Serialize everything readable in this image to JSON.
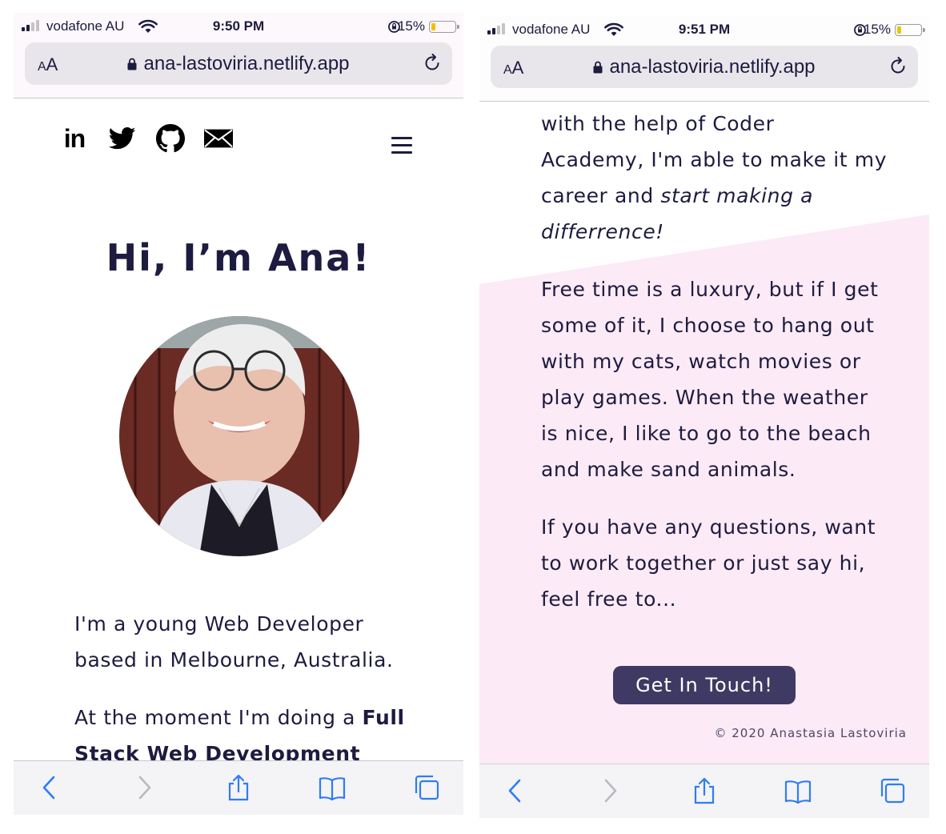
{
  "status_left": {
    "carrier": "vodafone AU",
    "time": "9:50 PM",
    "battery_percent": "15%",
    "battery_level": 0.15
  },
  "status_right": {
    "carrier": "vodafone AU",
    "time": "9:51 PM",
    "battery_percent": "15%",
    "battery_level": 0.15
  },
  "browser": {
    "text_size_label_small": "A",
    "text_size_label_large": "A",
    "url": "ana-lastoviria.netlify.app"
  },
  "nav": {
    "socials": [
      "linkedin-icon",
      "twitter-icon",
      "github-icon",
      "mail-icon"
    ],
    "linkedin_text": "in",
    "menu_icon": "hamburger-menu-icon"
  },
  "hero": {
    "title": "Hi, I’m Ana!"
  },
  "left_prose": {
    "p1_line1": "I'm a young Web Developer",
    "p1_line2": "based in Melbourne, Australia.",
    "p2_line1_a": "At the moment I'm doing a ",
    "p2_line1_b": "Full",
    "p2_line2": "Stack Web Development"
  },
  "right_prose": {
    "p1_line1": "with the help of Coder",
    "p1_line2": "Academy, I'm able to make it my",
    "p1_line3_a": "career and ",
    "p1_line3_b": "start making a",
    "p1_line4": "differrence!",
    "p2_lines": [
      "Free time is a luxury, but if I get",
      "some of it, I choose to hang out",
      "with my cats, watch movies or",
      "play games. When the weather",
      "is nice, I like to go to the beach",
      "and make sand animals."
    ],
    "p3_lines": [
      "If you have any questions, want",
      "to work together or just say hi,",
      "feel free to..."
    ]
  },
  "cta": {
    "label": "Get In Touch!"
  },
  "footer": {
    "copyright": "© 2020 Anastasia Lastoviria"
  },
  "toolbar": {
    "icons": [
      "back-icon",
      "forward-icon",
      "share-icon",
      "bookmarks-icon",
      "tabs-icon"
    ]
  },
  "colors": {
    "ink": "#1d1b3f",
    "accent_button": "#3e3a63",
    "pink_section": "#fceaf6",
    "ios_blue": "#2f7cf6",
    "battery_yellow": "#f6c000"
  }
}
